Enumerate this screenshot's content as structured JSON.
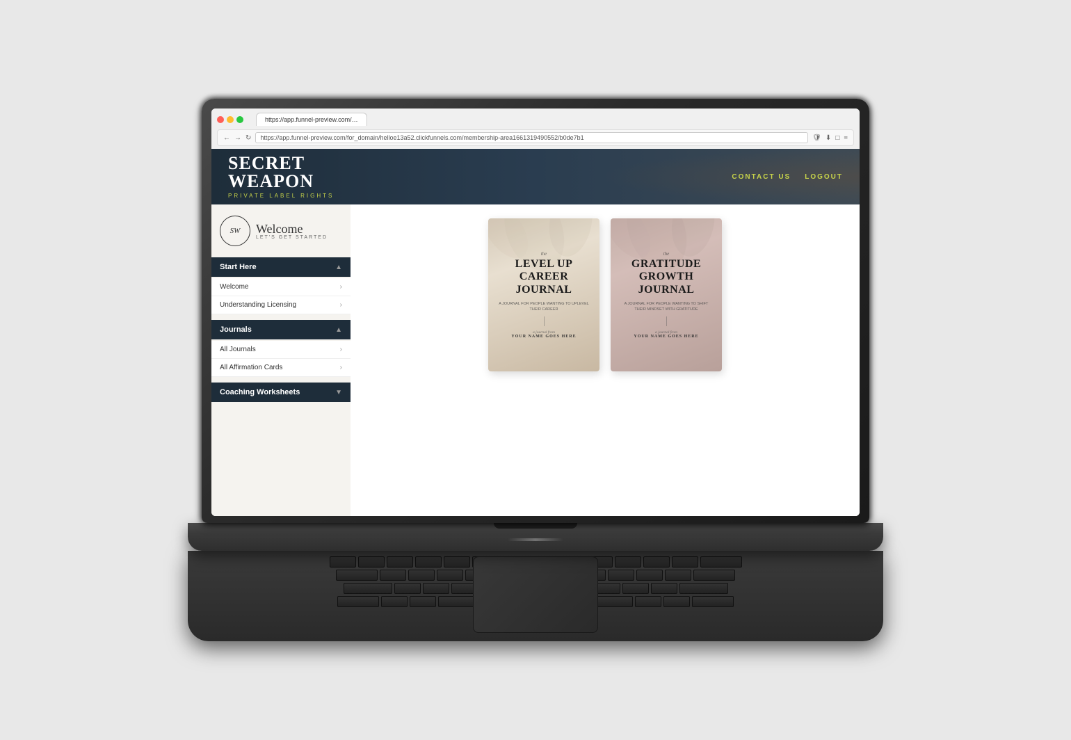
{
  "browser": {
    "tab_text": "https://app.funnel-preview.com/for_domain/helloe13a52.clickfunnels.com/membership-area1661319490552/b0de7b1",
    "url": "https://app.funnel-preview.com/for_domain/helloe13a52.clickfunnels.com/membership-area1661319490552/b0de7b1"
  },
  "site": {
    "logo": {
      "line1": "SECRET",
      "line2": "WEAPON",
      "subtitle": "PRIVATE LABEL RIGHTS"
    },
    "nav": {
      "contact": "CONTACT US",
      "logout": "LOGOUT"
    }
  },
  "sidebar": {
    "welcome_script": "Welcome",
    "lets_get_started": "LET'S GET STARTED",
    "sw_monogram": "SW",
    "sections": [
      {
        "title": "Start Here",
        "items": [
          "Welcome",
          "Understanding Licensing"
        ]
      },
      {
        "title": "Journals",
        "items": [
          "All Journals",
          "All Affirmation Cards"
        ]
      },
      {
        "title": "Coaching Worksheets",
        "items": []
      }
    ]
  },
  "journals": [
    {
      "id": "level-up",
      "the_label": "the",
      "title_line1": "LEVEL UP",
      "title_line2": "CAREER",
      "title_line3": "JOURNAL",
      "subtitle": "A JOURNAL FOR PEOPLE WANTING TO UPLEVEL THEIR CAREER",
      "from_label": "a journal from",
      "name_placeholder": "YOUR NAME GOES HERE"
    },
    {
      "id": "gratitude",
      "the_label": "the",
      "title_line1": "GRATITUDE",
      "title_line2": "GROWTH",
      "title_line3": "JOURNAL",
      "subtitle": "A JOURNAL FOR PEOPLE WANTING TO SHIFT THEIR MINDSET WITH GRATITUDE",
      "from_label": "a journal from",
      "name_placeholder": "YOUR NAME GOES HERE"
    }
  ]
}
